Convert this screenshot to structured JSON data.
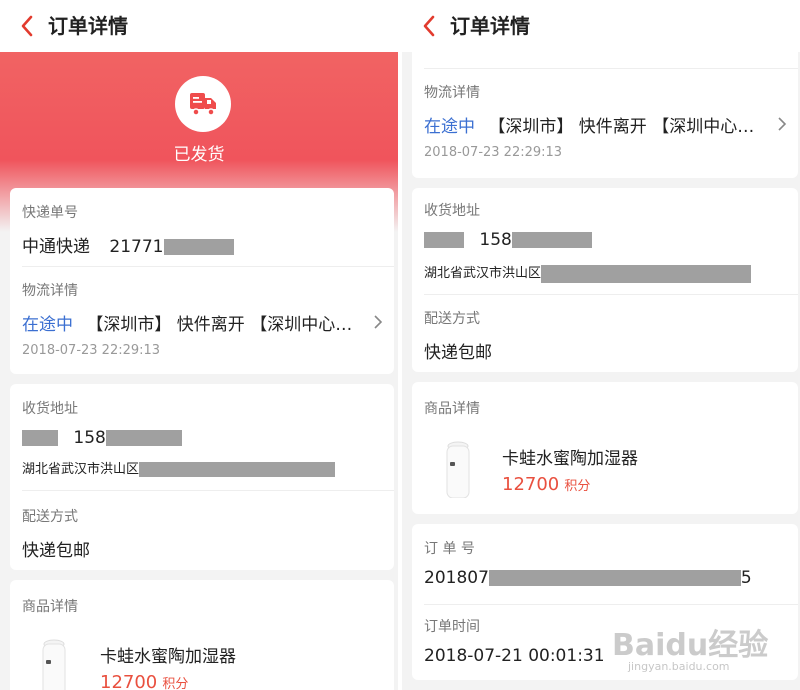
{
  "header": {
    "title": "订单详情"
  },
  "shipment": {
    "status": "已发货",
    "tracking_label": "快递单号",
    "carrier": "中通快递",
    "tracking_no": "21771",
    "logistics_label": "物流详情",
    "logistics_state": "在途中",
    "logistics_text": "【深圳市】 快件离开 【深圳中心…",
    "logistics_time": "2018-07-23 22:29:13"
  },
  "address": {
    "label": "收货地址",
    "phone_prefix": "158",
    "region": "湖北省武汉市洪山区"
  },
  "delivery": {
    "label": "配送方式",
    "method": "快递包邮"
  },
  "product": {
    "section_label": "商品详情",
    "name": "卡蛙水蜜陶加湿器",
    "points": "12700",
    "points_unit": "积分"
  },
  "order": {
    "number_label": "订 单 号",
    "number_prefix": "201807",
    "number_suffix": "5",
    "time_label": "订单时间",
    "time": "2018-07-21 00:01:31"
  },
  "watermark": {
    "text": "Baidu经验",
    "sub": "jingyan.baidu.com"
  },
  "colors": {
    "accent": "#e9503f",
    "link": "#3b6fd1",
    "hero": "#f0545c"
  },
  "icons": {
    "back": "chevron-left-icon",
    "truck": "truck-icon",
    "more": "chevron-right-icon"
  }
}
